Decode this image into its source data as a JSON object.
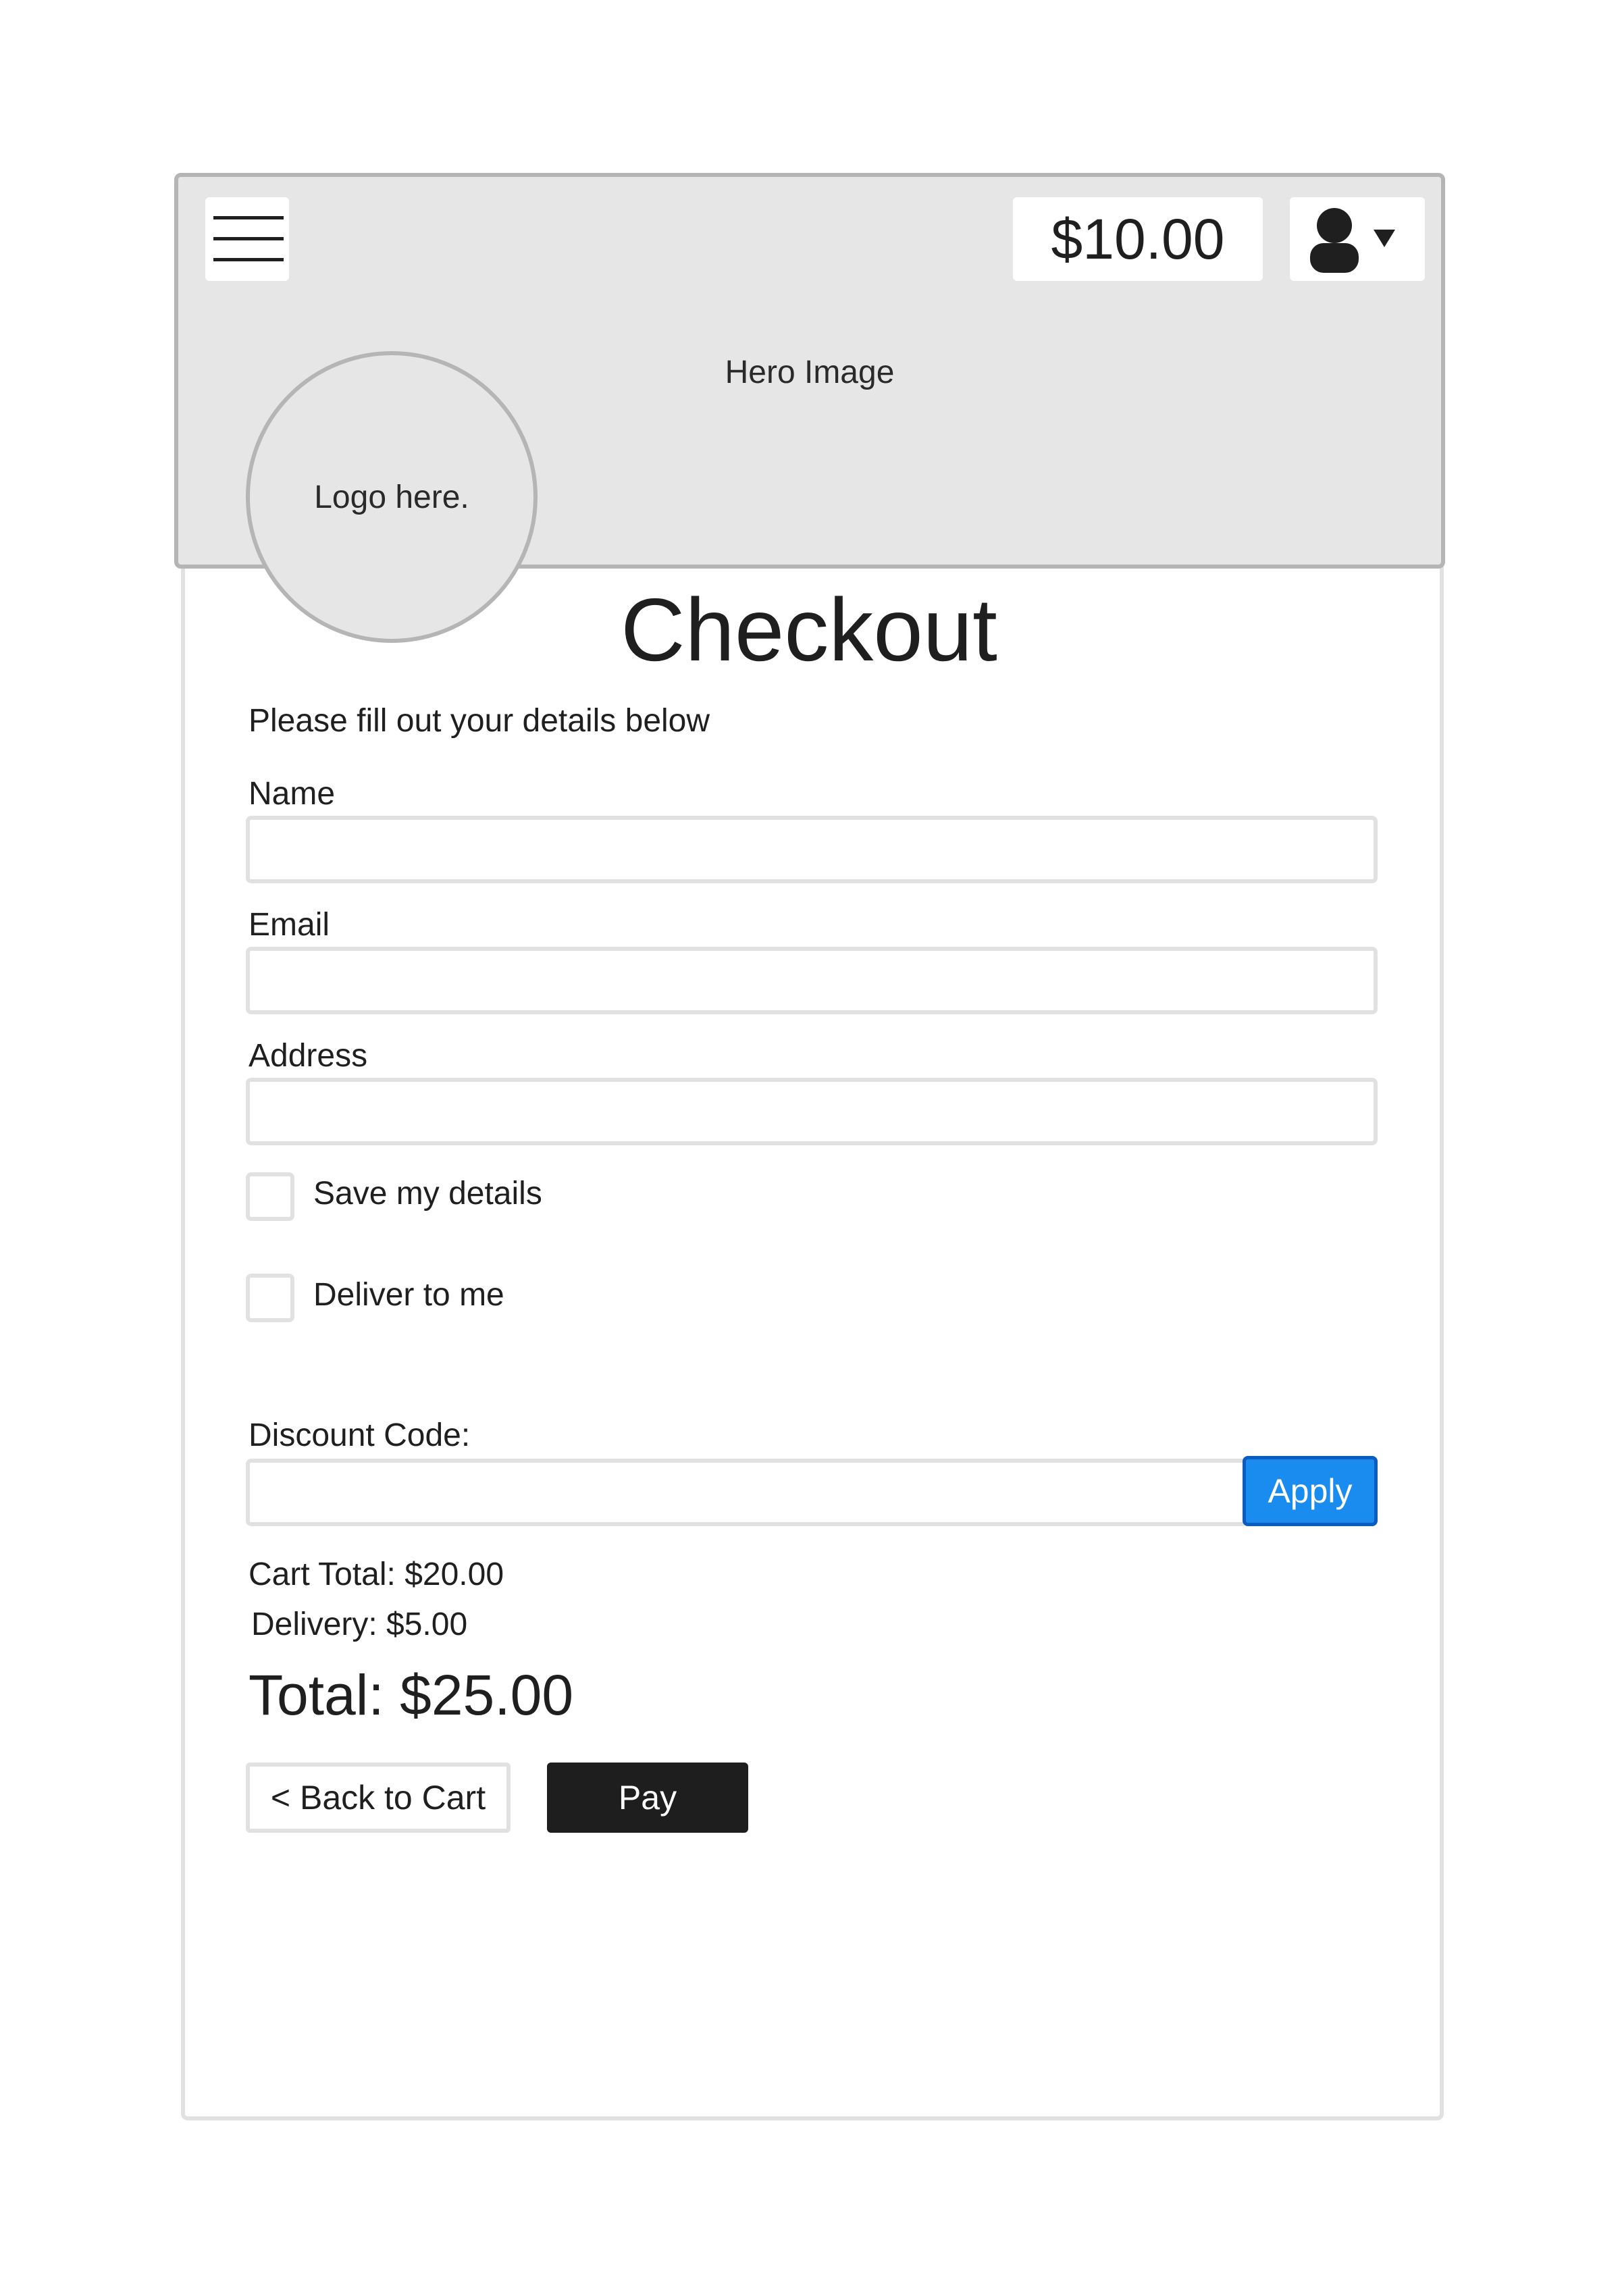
{
  "header": {
    "cart_amount": "$10.00",
    "hero_text": "Hero Image",
    "logo_text": "Logo here."
  },
  "page": {
    "title": "Checkout",
    "subtitle": "Please fill out your details below"
  },
  "form": {
    "name_label": "Name",
    "name_value": "",
    "email_label": "Email",
    "email_value": "",
    "address_label": "Address",
    "address_value": "",
    "save_details_label": "Save my details",
    "save_details_checked": false,
    "deliver_label": "Deliver to me",
    "deliver_checked": false,
    "discount_label": "Discount Code:",
    "discount_value": "",
    "apply_label": "Apply"
  },
  "summary": {
    "cart_total": "Cart Total: $20.00",
    "delivery": "Delivery: $5.00",
    "total": "Total: $25.00"
  },
  "actions": {
    "back_label": "< Back to Cart",
    "pay_label": "Pay"
  },
  "colors": {
    "accent": "#1a8cf0",
    "pay_button": "#1e1e1e",
    "hero_bg": "#e6e6e6"
  },
  "icons": {
    "menu": "hamburger-menu-icon",
    "user": "user-icon",
    "dropdown": "caret-down-icon"
  }
}
